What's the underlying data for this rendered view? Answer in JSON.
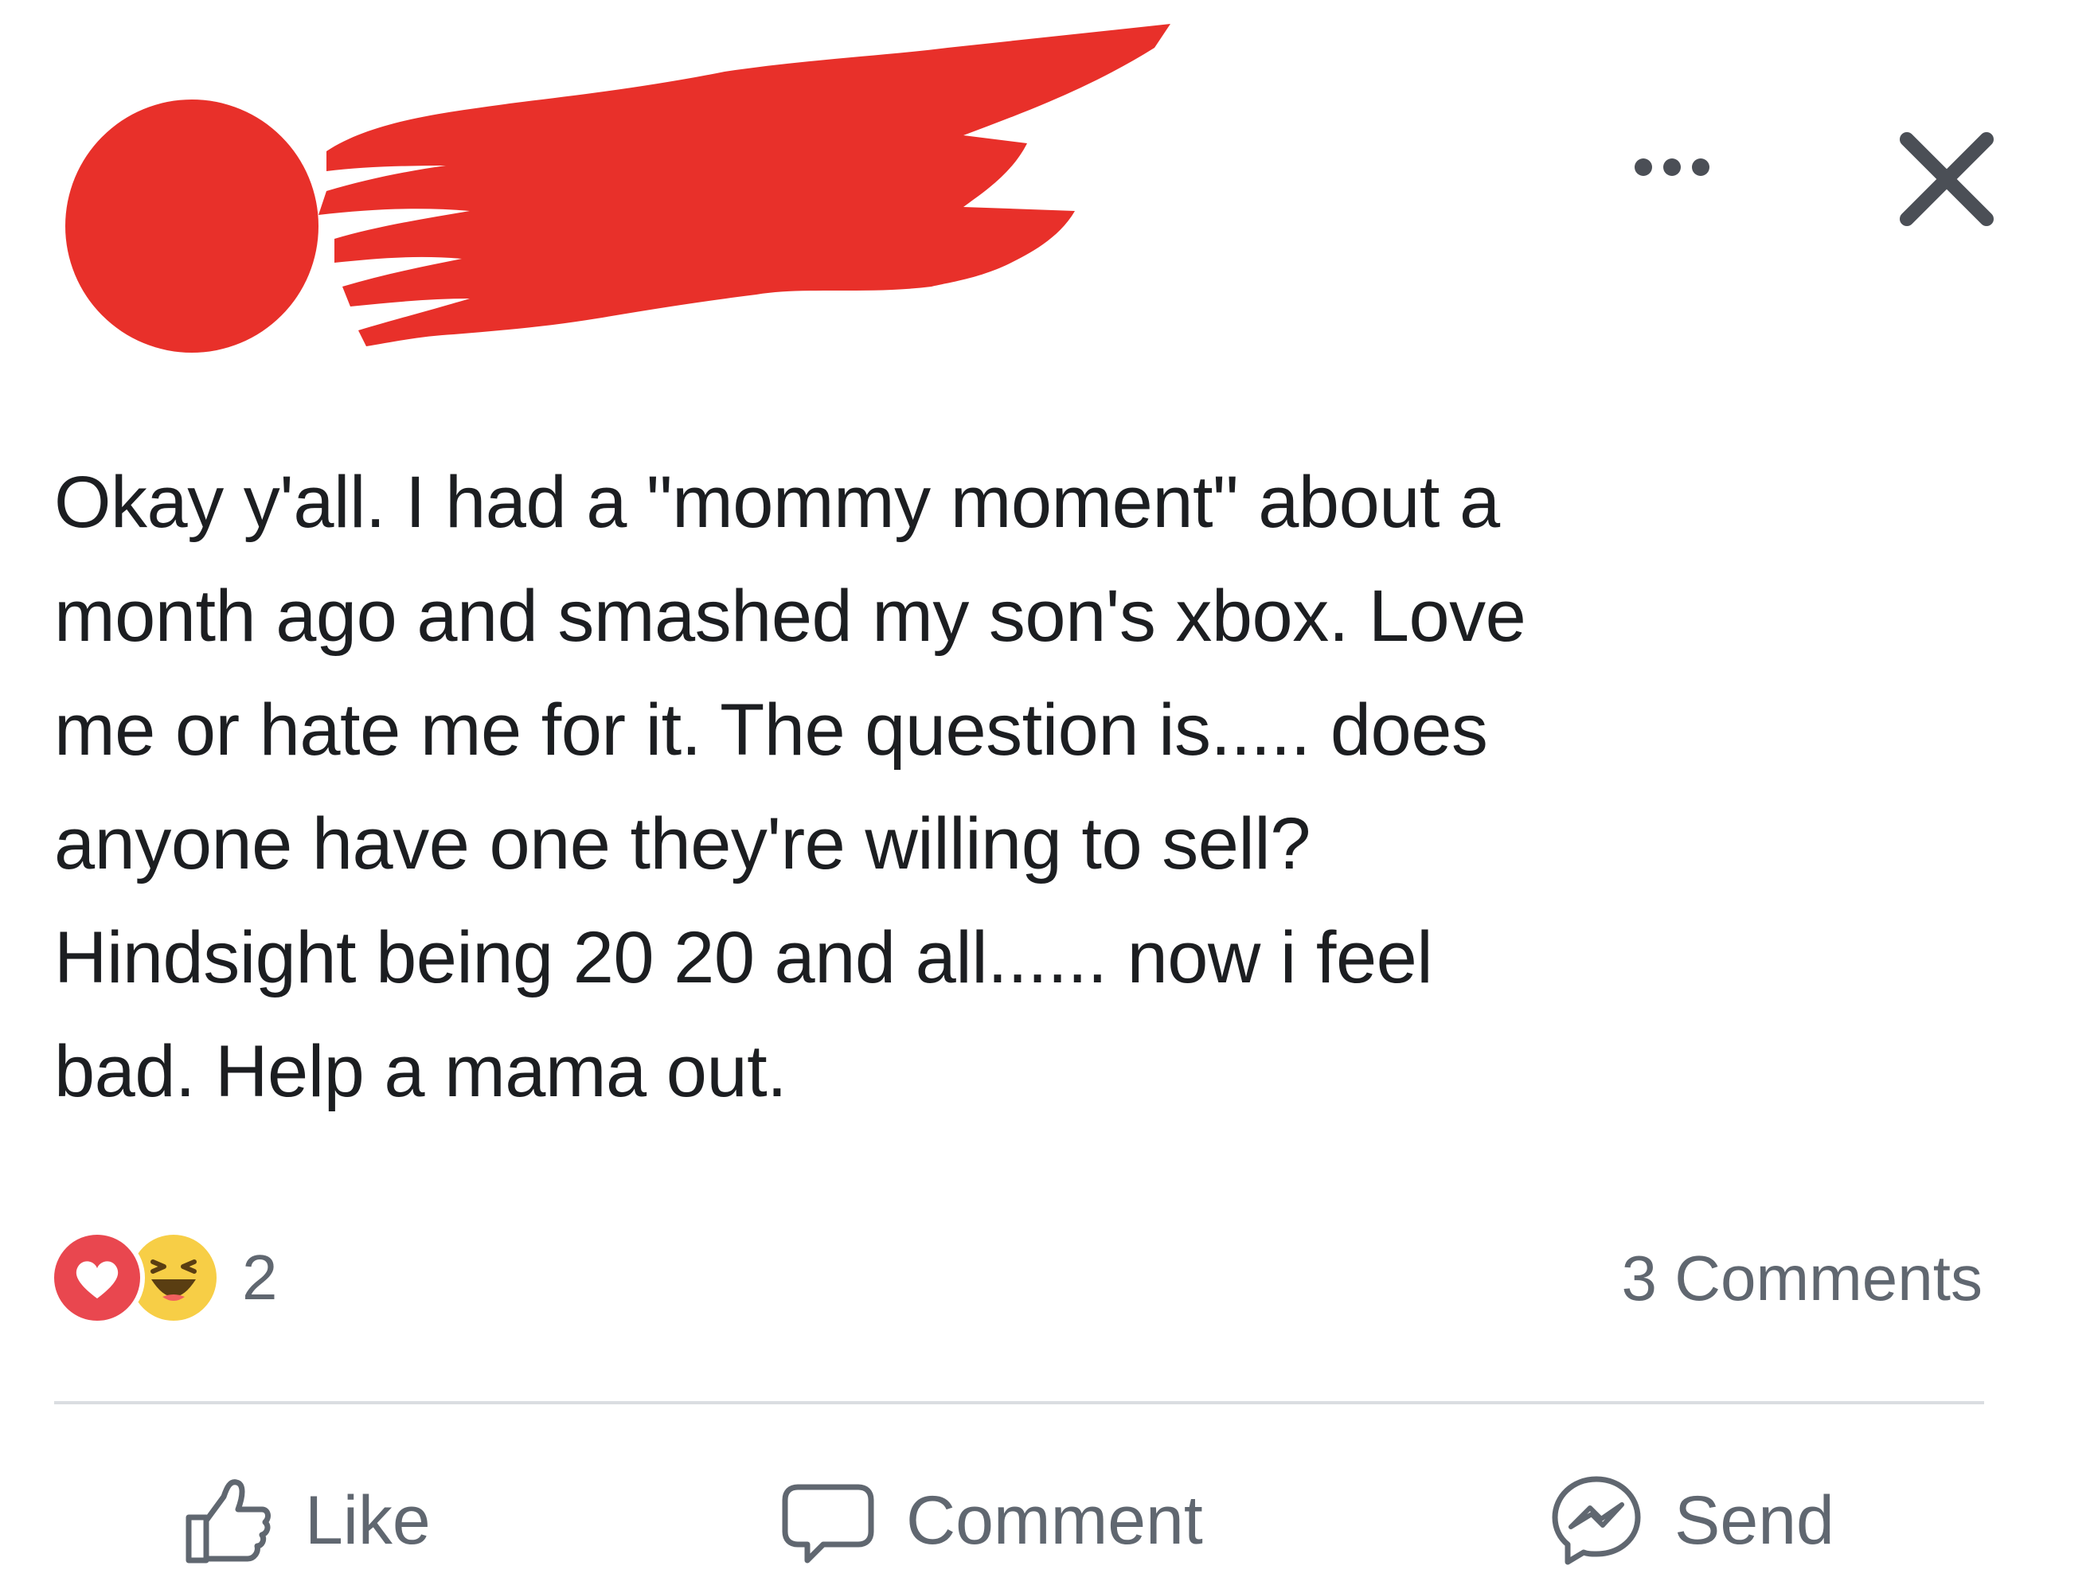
{
  "post": {
    "author": {
      "avatar_color": "#e8302a",
      "redaction_color": "#e8302a"
    },
    "header_actions": {
      "more_icon": "more-options-icon",
      "close_icon": "close-icon"
    },
    "text_lines": [
      "Okay y'all. I had a \"mommy moment\" about a",
      "month ago and smashed my son's xbox. Love",
      "me or hate me for it. The question is..... does",
      "anyone have one they're willing to sell?",
      "Hindsight being 20 20 and all...... now i feel",
      "bad. Help a mama out."
    ],
    "reactions": {
      "icons": [
        "love-reaction-icon",
        "haha-reaction-icon"
      ],
      "count": "2"
    },
    "comments_count": "3 Comments",
    "actions": {
      "like": "Like",
      "comment": "Comment",
      "send": "Send"
    },
    "colors": {
      "text": "#1c1e21",
      "secondary_text": "#606770",
      "love": "#e9474f",
      "haha": "#f7ce46",
      "divider": "#dadde1"
    }
  }
}
